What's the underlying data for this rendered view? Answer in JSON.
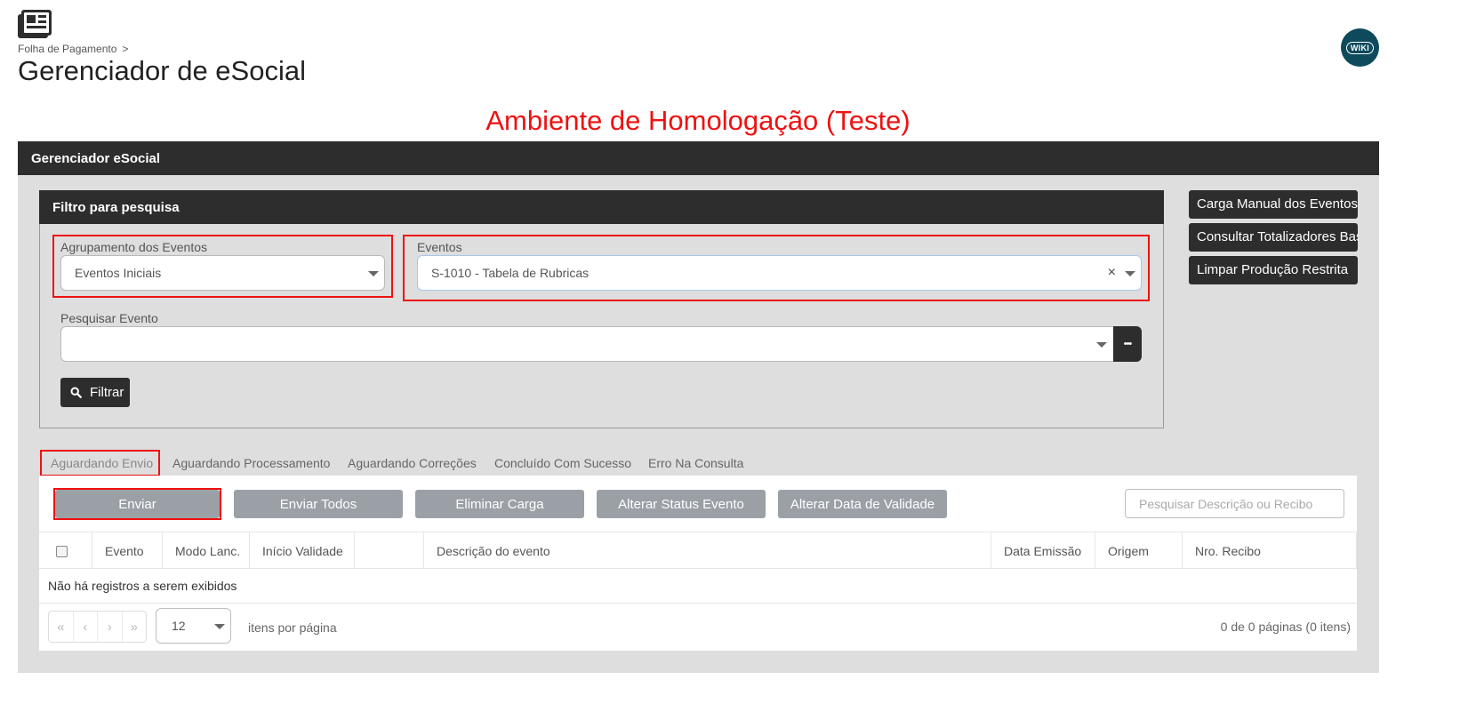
{
  "breadcrumb": {
    "parent": "Folha de Pagamento",
    "separator": ">"
  },
  "page_title": "Gerenciador de eSocial",
  "wiki_label": "WIKI",
  "environment_banner": "Ambiente de Homologação (Teste)",
  "panel": {
    "title": "Gerenciador eSocial"
  },
  "filter": {
    "title": "Filtro para pesquisa",
    "grouping_label": "Agrupamento dos Eventos",
    "grouping_value": "Eventos Iniciais",
    "events_label": "Eventos",
    "events_value": "S-1010 - Tabela de Rubricas",
    "clear_symbol": "×",
    "search_label": "Pesquisar Evento",
    "search_value": "",
    "more_symbol": "•••",
    "filter_button": "Filtrar"
  },
  "side_buttons": [
    "Carga Manual dos Eventos",
    "Consultar Totalizadores Base",
    "Limpar Produção Restrita"
  ],
  "tabs": [
    "Aguardando Envio",
    "Aguardando Processamento",
    "Aguardando Correções",
    "Concluído Com Sucesso",
    "Erro Na Consulta"
  ],
  "active_tab": "Aguardando Envio",
  "actions": [
    "Enviar",
    "Enviar Todos",
    "Eliminar Carga",
    "Alterar Status Evento",
    "Alterar Data de Validade"
  ],
  "search_desc_placeholder": "Pesquisar Descrição ou Recibo",
  "grid": {
    "columns": [
      "Evento",
      "Modo Lanc.",
      "Início Validade",
      "",
      "Descrição do evento",
      "Data Emissão",
      "Origem",
      "Nro. Recibo"
    ],
    "empty_message": "Não há registros a serem exibidos"
  },
  "pager": {
    "first": "«",
    "prev": "‹",
    "next": "›",
    "last": "»",
    "page_size": "12",
    "per_page_label": "itens por página",
    "info": "0 de 0 páginas (0 itens)"
  },
  "colors": {
    "highlight": "#ee1111",
    "dark": "#2d2d2d",
    "button_gray": "#9aa0a6",
    "wiki": "#0d4a5c"
  },
  "icons": {
    "app": "newspaper-icon",
    "search": "search-icon",
    "caret": "chevron-down-icon"
  }
}
